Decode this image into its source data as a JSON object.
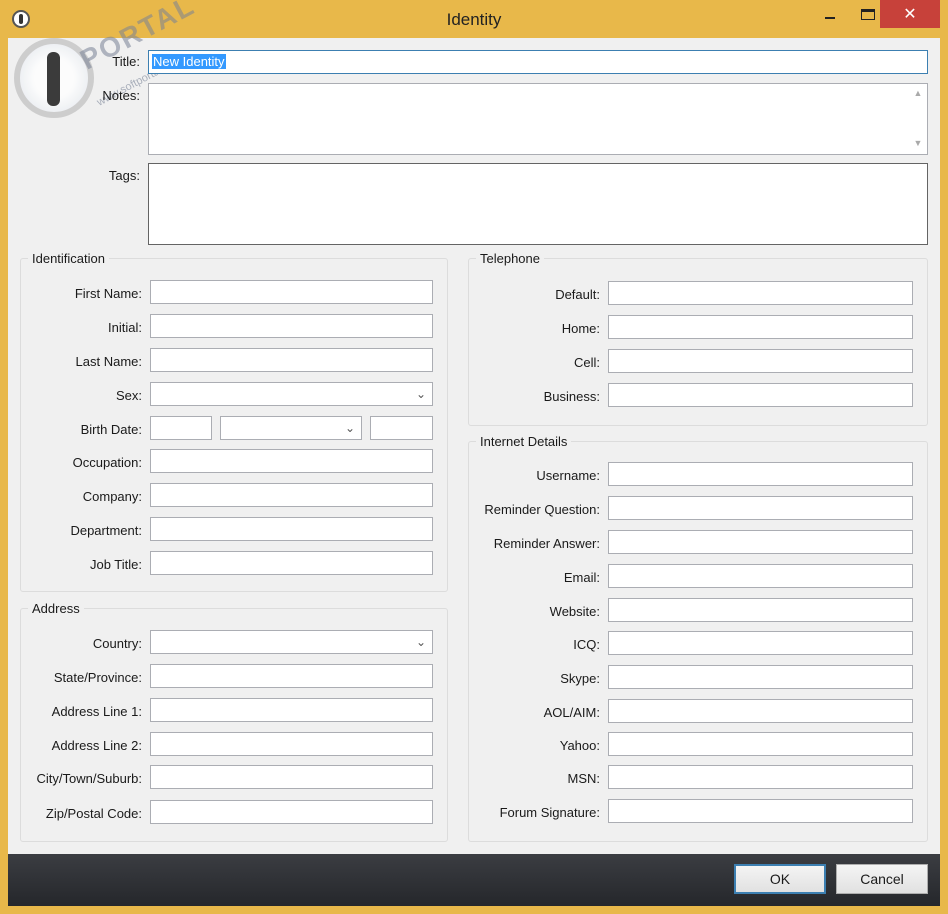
{
  "window": {
    "title": "Identity",
    "close_glyph": "✕"
  },
  "watermark": {
    "brand": "PORTAL",
    "url": "www.softportal.com"
  },
  "top": {
    "title_label": "Title:",
    "title_value": "New Identity",
    "notes_label": "Notes:",
    "tags_label": "Tags:"
  },
  "identification": {
    "heading": "Identification",
    "first_name": "First Name:",
    "initial": "Initial:",
    "last_name": "Last Name:",
    "sex": "Sex:",
    "birth_date": "Birth Date:",
    "occupation": "Occupation:",
    "company": "Company:",
    "department": "Department:",
    "job_title": "Job Title:"
  },
  "address": {
    "heading": "Address",
    "country": "Country:",
    "state": "State/Province:",
    "line1": "Address Line 1:",
    "line2": "Address Line 2:",
    "city": "City/Town/Suburb:",
    "zip": "Zip/Postal Code:"
  },
  "telephone": {
    "heading": "Telephone",
    "default": "Default:",
    "home": "Home:",
    "cell": "Cell:",
    "business": "Business:"
  },
  "internet": {
    "heading": "Internet Details",
    "username": "Username:",
    "reminder_question": "Reminder Question:",
    "reminder_answer": "Reminder Answer:",
    "email": "Email:",
    "website": "Website:",
    "icq": "ICQ:",
    "skype": "Skype:",
    "aol": "AOL/AIM:",
    "yahoo": "Yahoo:",
    "msn": "MSN:",
    "forum_signature": "Forum Signature:"
  },
  "footer": {
    "ok": "OK",
    "cancel": "Cancel"
  },
  "glyphs": {
    "chevron_down": "⌄",
    "scroll_up": "▲",
    "scroll_down": "▼"
  },
  "colors": {
    "title_bar": "#e8b84a",
    "close_button": "#c7413a",
    "selection": "#3399ff",
    "footer": "#2e3034"
  }
}
